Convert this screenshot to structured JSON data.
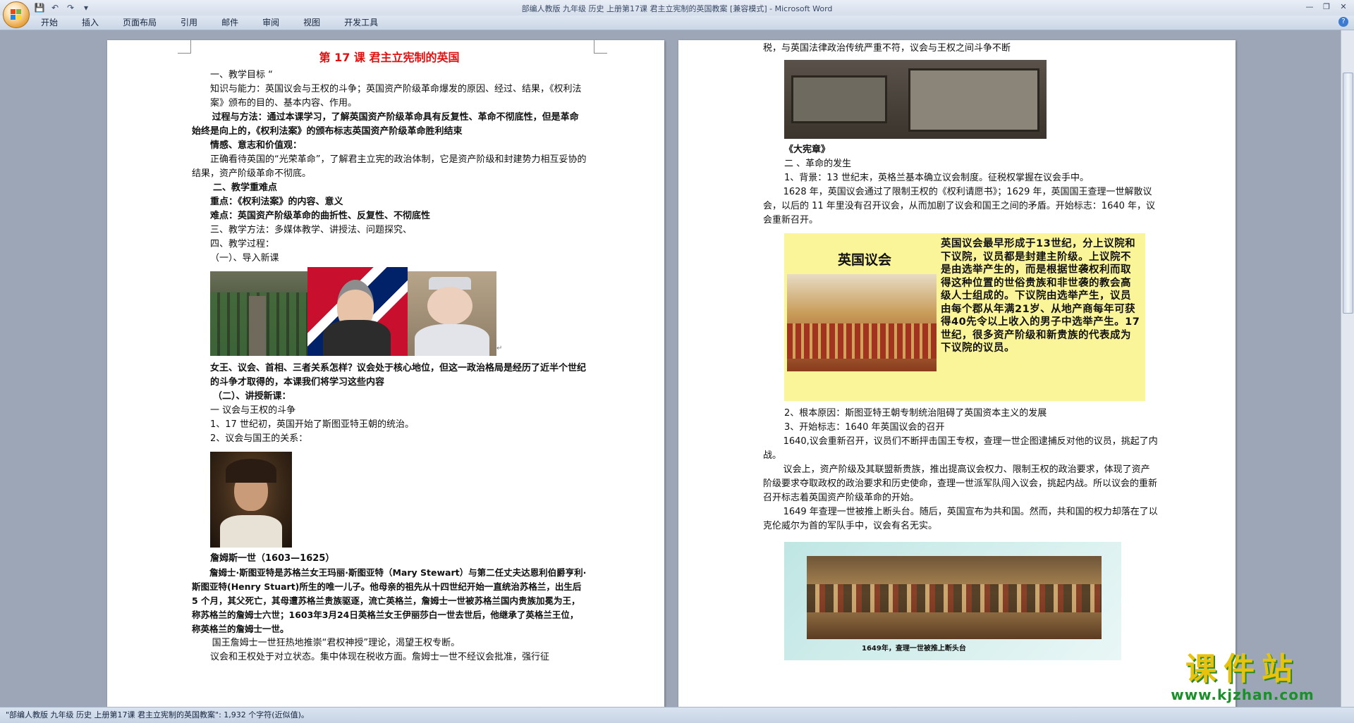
{
  "window": {
    "title": "部编人教版 九年级 历史 上册第17课 君主立宪制的英国教案 [兼容模式] - Microsoft Word",
    "controls": [
      "—",
      "❐",
      "✕"
    ]
  },
  "qat": {
    "save_icon": "save-icon",
    "undo_icon": "undo-icon",
    "redo_icon": "redo-icon"
  },
  "ribbon": {
    "tabs": [
      "开始",
      "插入",
      "页面布局",
      "引用",
      "邮件",
      "审阅",
      "视图",
      "开发工具"
    ],
    "help": "?"
  },
  "page1": {
    "title": "第 17 课      君主立宪制的英国",
    "lines": [
      "一、教学目标 “",
      "知识与能力：英国议会与王权的斗争；英国资产阶级革命爆发的原因、经过、结果，《权利法案》颁布的目的、基本内容、作用。",
      "过程与方法：通过本课学习，了解英国资产阶级革命具有反复性、革命不彻底性，但是革命始终是向上的，《权利法案》的颁布标志英国资产阶级革命胜利结束",
      "情感、意志和价值观：",
      "正确看待英国的“光荣革命”，了解君主立宪的政治体制，它是资产阶级和封建势力相互妥协的结果，资产阶级革命不彻底。",
      "二、教学重难点",
      "重点：《权利法案》的内容、意义",
      "难点：英国资产阶级革命的曲折性、反复性、不彻底性",
      "三、教学方法：多媒体教学、讲授法、问题探究、",
      "四、教学过程：",
      "（一）、导入新课"
    ],
    "question": "女王、议会、首相、三者关系怎样？议会处于核心地位，但这一政治格局是经历了近半个世纪的斗争才取得的，本课我们将学习这些内容",
    "lines2": [
      "（二）、讲授新课：",
      "一   议会与王权的斗争",
      "1、17 世纪初，英国开始了斯图亚特王朝的统治。",
      "2、议会与国王的关系："
    ],
    "caption": "詹姆斯一世（1603—1625）",
    "bio": "詹姆士·斯图亚特是苏格兰女王玛丽·斯图亚特（Mary Stewart）与第二任丈夫达恩利伯爵亨利·斯图亚特(Henry Stuart)所生的唯一儿子。他母亲的祖先从十四世纪开始一直统治苏格兰，出生后 5 个月，其父死亡，其母遭苏格兰贵族驱逐，流亡英格兰，詹姆士一世被苏格兰国内贵族加冕为王，称苏格兰的詹姆士六世；1603年3月24日英格兰女王伊丽莎白一世去世后，他继承了英格兰王位，称英格兰的詹姆士一世。",
    "tail1": "国王詹姆士一世狂热地推崇“君权神授”理论，渴望王权专断。",
    "tail2": "议会和王权处于对立状态。集中体现在税收方面。詹姆士一世不经议会批准，强行征"
  },
  "page2": {
    "line0": "税，与英国法律政治传统严重不符，议会与王权之间斗争不断",
    "img1_caption": "《大宪章》",
    "lines": [
      "二    、革命的发生",
      "1、背景：13 世纪末，英格兰基本确立议会制度。征税权掌握在议会手中。",
      "1628 年，英国议会通过了限制王权的《权利请愿书》；1629 年，英国国王查理一世解散议会，以后的 11 年里没有召开议会，从而加剧了议会和国王之间的矛盾。开始标志：1640 年，议会重新召开。"
    ],
    "parliament_box": {
      "heading": "英国议会",
      "text": "英国议会最早形成于13世纪，分上议院和下议院，议员都是封建主阶级。上议院不是由选举产生的，而是根据世袭权利而取得这种位置的世俗贵族和非世袭的教会高级人士组成的。下议院由选举产生，议员由每个郡从年满21岁、从地产商每年可获得40先令以上收入的男子中选举产生。17世纪，很多资产阶级和新贵族的代表成为下议院的议员。"
    },
    "lines2": [
      "2、根本原因：斯图亚特王朝专制统治阻碍了英国资本主义的发展",
      "3、开始标志：1640 年英国议会的召开",
      "1640,议会重新召开，议员们不断抨击国王专权，查理一世企图逮捕反对他的议员，挑起了内战。",
      "议会上，资产阶级及其联盟新贵族，推出提高议会权力、限制王权的政治要求，体现了资产阶级要求夺取政权的政治要求和历史使命，查理一世派军队闯入议会，挑起内战。所以议会的重新召开标志着英国资产阶级革命的开始。",
      "1649 年查理一世被推上断头台。随后，英国宣布为共和国。然而，共和国的权力却落在了以克伦威尔为首的军队手中，议会有名无实。"
    ],
    "img3_caption": "1649年，查理一世被推上断头台"
  },
  "statusbar": {
    "text": "\"部编人教版 九年级 历史 上册第17课 君主立宪制的英国教案\": 1,932 个字符(近似值)。"
  },
  "watermark": {
    "cn": "课件站",
    "url": "www.kjzhan.com"
  },
  "colors": {
    "title_red": "#e01010",
    "box_yellow": "#fbf59a",
    "watermark_yellow": "#e8c20c",
    "watermark_green": "#1b8f2a"
  }
}
